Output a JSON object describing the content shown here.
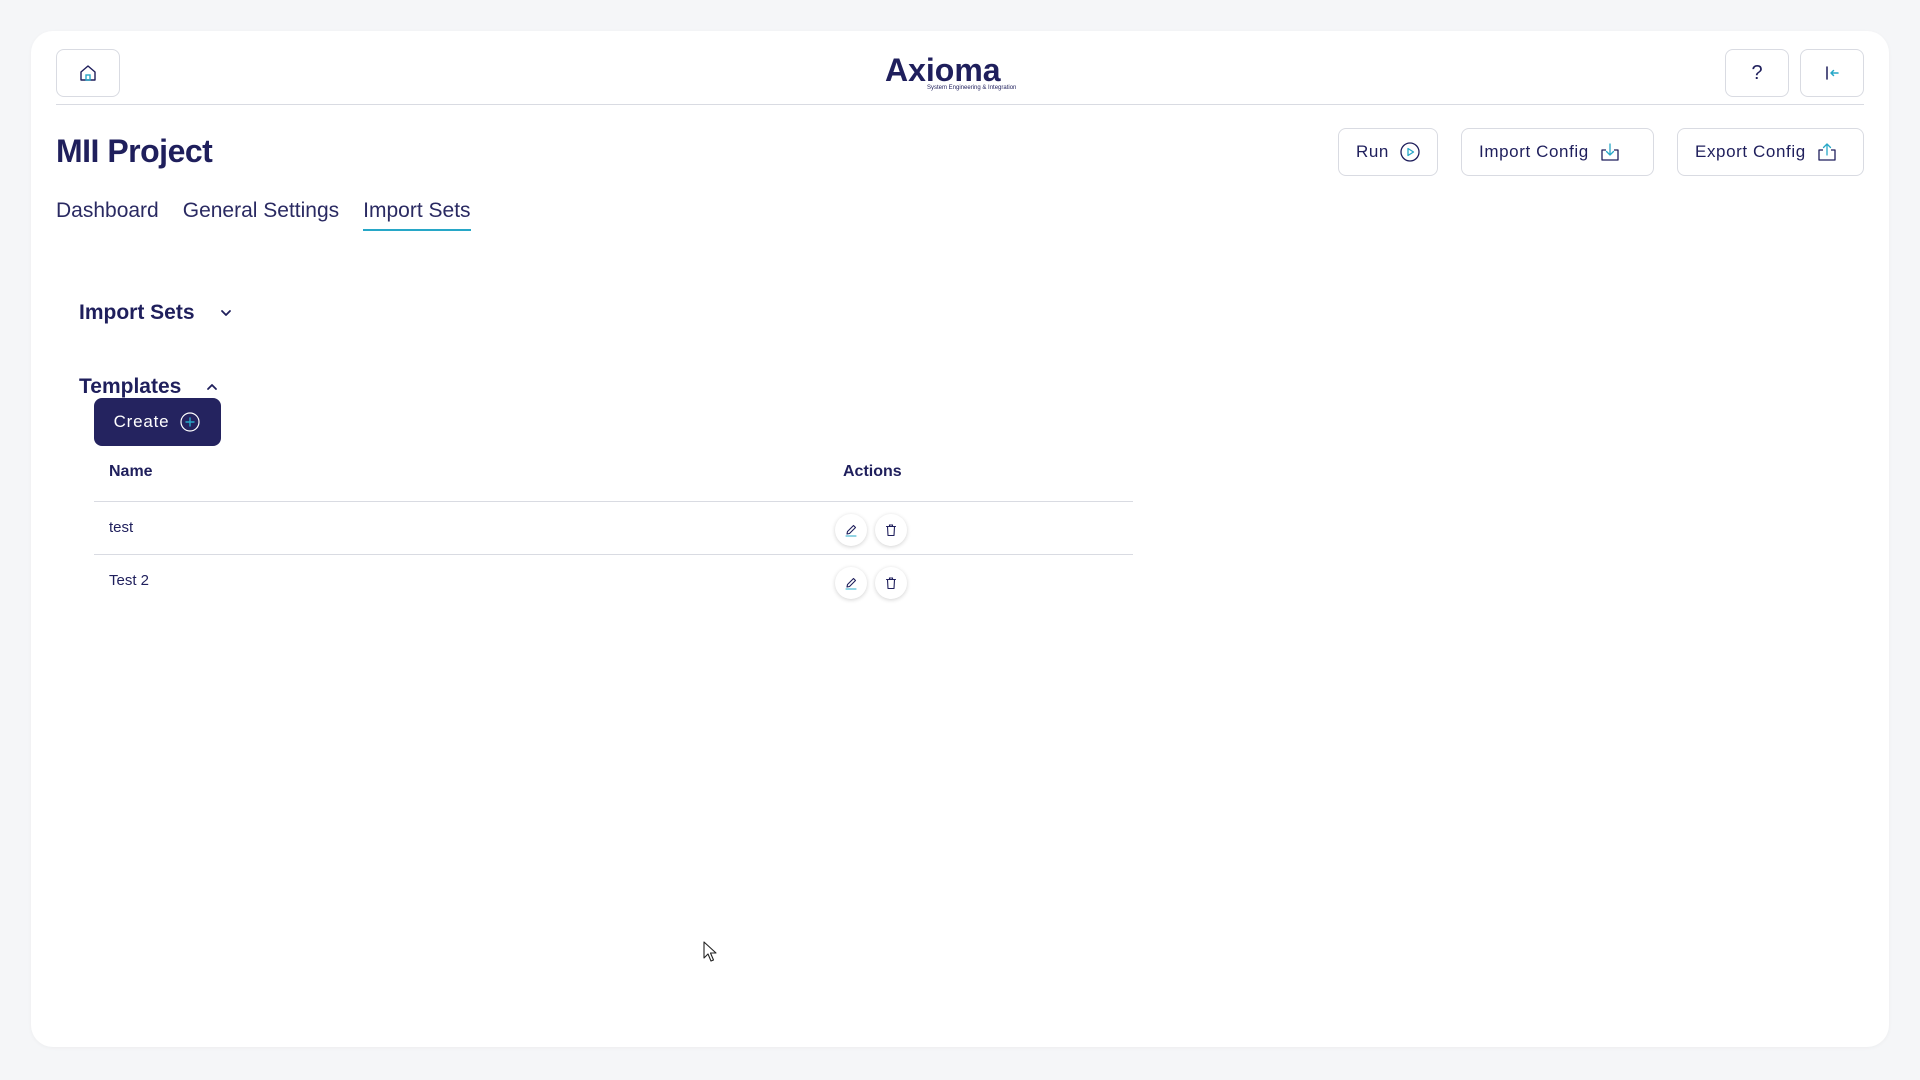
{
  "header": {
    "logo_text": "Axioma",
    "logo_subtext": "System Engineering & Integration",
    "help_label": "?"
  },
  "page": {
    "title": "MII Project"
  },
  "toolbar": {
    "run_label": "Run",
    "import_config_label": "Import Config",
    "export_config_label": "Export Config"
  },
  "tabs": [
    {
      "label": "Dashboard",
      "active": false
    },
    {
      "label": "General Settings",
      "active": false
    },
    {
      "label": "Import Sets",
      "active": true
    }
  ],
  "sections": {
    "import_sets": {
      "label": "Import Sets",
      "expanded": false
    },
    "templates": {
      "label": "Templates",
      "expanded": true
    }
  },
  "templates": {
    "create_label": "Create",
    "columns": [
      "Name",
      "Actions"
    ],
    "rows": [
      {
        "name": "test"
      },
      {
        "name": "Test 2"
      }
    ]
  },
  "colors": {
    "primary": "#24235f",
    "accent": "#27a7c7",
    "border": "#d9dbe2"
  },
  "icons": {
    "home": "home-icon",
    "help": "help-icon",
    "logout": "logout-icon",
    "run": "play-circle-icon",
    "import": "download-tray-icon",
    "export": "upload-tray-icon",
    "create": "plus-circle-icon",
    "edit": "pencil-icon",
    "delete": "trash-icon"
  }
}
